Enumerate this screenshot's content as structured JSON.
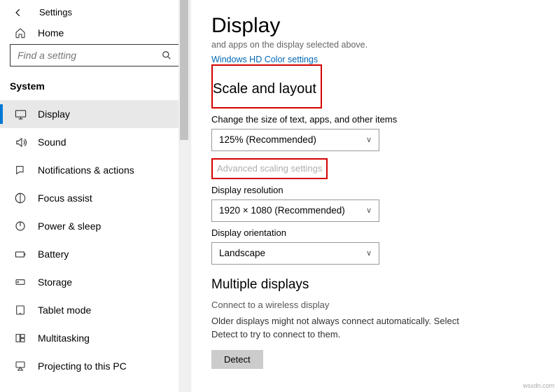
{
  "app_title": "Settings",
  "home_label": "Home",
  "search": {
    "placeholder": "Find a setting"
  },
  "section_label": "System",
  "nav": {
    "display": "Display",
    "sound": "Sound",
    "notifications": "Notifications & actions",
    "focus": "Focus assist",
    "power": "Power & sleep",
    "battery": "Battery",
    "storage": "Storage",
    "tablet": "Tablet mode",
    "multitasking": "Multitasking",
    "projecting": "Projecting to this PC"
  },
  "page": {
    "title": "Display",
    "cropped_line": "and apps on the display selected above.",
    "hd_color_link": "Windows HD Color settings",
    "scale_heading": "Scale and layout",
    "scale_label": "Change the size of text, apps, and other items",
    "scale_value": "125% (Recommended)",
    "advanced_link": "Advanced scaling settings",
    "resolution_label": "Display resolution",
    "resolution_value": "1920 × 1080 (Recommended)",
    "orientation_label": "Display orientation",
    "orientation_value": "Landscape",
    "multi_heading": "Multiple displays",
    "wireless_link": "Connect to a wireless display",
    "detect_desc": "Older displays might not always connect automatically. Select Detect to try to connect to them.",
    "detect_button": "Detect"
  },
  "watermark": "wsxdn.com"
}
